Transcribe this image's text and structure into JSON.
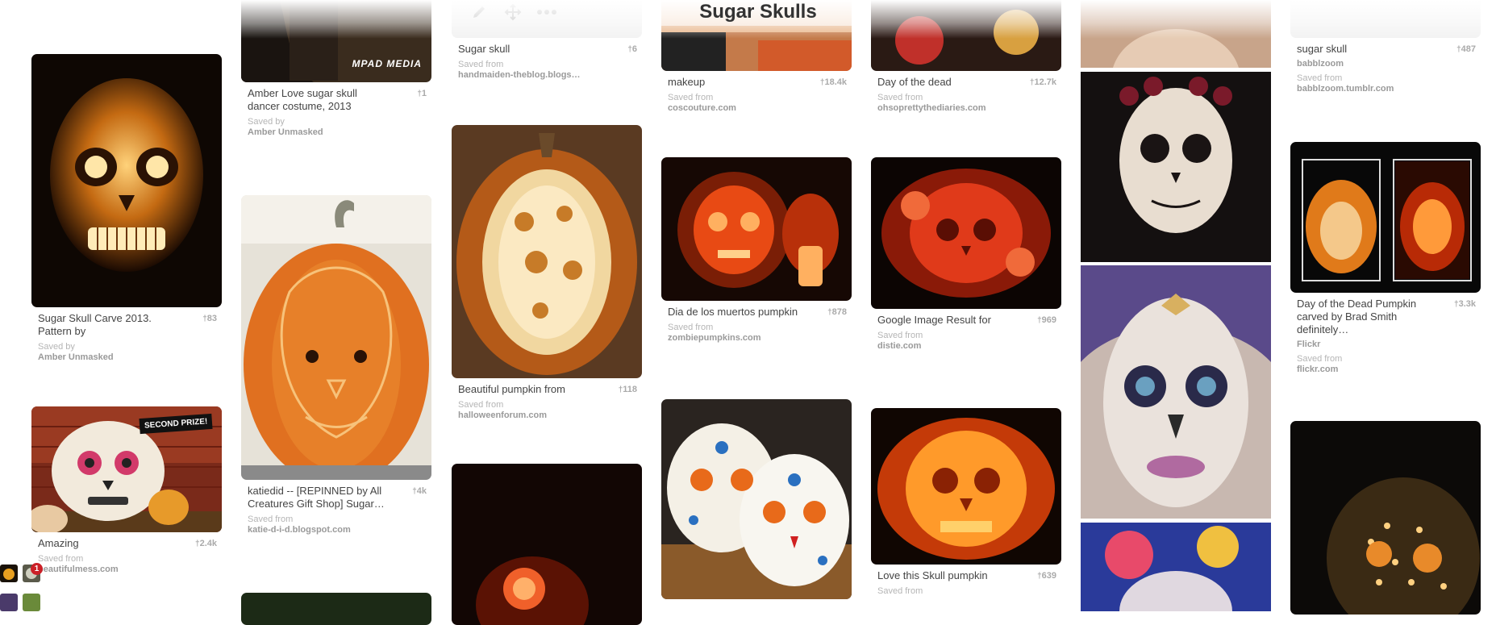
{
  "board": {
    "title": "Sugar Skulls"
  },
  "toolbar": {
    "edit_icon": "pencil-icon",
    "move_icon": "move-icon",
    "more_icon": "more-icon"
  },
  "notifications": {
    "count": "1"
  },
  "pins": {
    "p_amber_love": {
      "desc": "Amber Love sugar skull dancer costume, 2013",
      "repins": "1",
      "saved_label": "Saved by",
      "source": "Amber Unmasked",
      "watermark": "MPAD MEDIA"
    },
    "p_sugar_skull_carve": {
      "desc": "Sugar Skull Carve 2013. Pattern by",
      "repins": "83",
      "saved_label": "Saved by",
      "source": "Amber Unmasked"
    },
    "p_amazing": {
      "desc": "Amazing",
      "repins": "2.4k",
      "saved_label": "Saved from",
      "source": "beautifulmess.com",
      "banner": "SECOND PRIZE!"
    },
    "p_katiedid": {
      "desc": "katiedid -- [REPINNED by All Creatures Gift Shop] Sugar…",
      "repins": "4k",
      "saved_label": "Saved from",
      "source": "katie-d-i-d.blogspot.com"
    },
    "p_sugar_skull": {
      "desc": "Sugar skull",
      "repins": "6",
      "saved_label": "Saved from",
      "source": "handmaiden-theblog.blogs…"
    },
    "p_beautiful_pumpkin": {
      "desc": "Beautiful pumpkin from",
      "repins": "118",
      "saved_label": "Saved from",
      "source": "halloweenforum.com"
    },
    "p_makeup": {
      "desc": "makeup",
      "repins": "18.4k",
      "saved_label": "Saved from",
      "source": "coscouture.com"
    },
    "p_dia_muertos": {
      "desc": "Dia de los muertos pumpkin",
      "repins": "878",
      "saved_label": "Saved from",
      "source": "zombiepumpkins.com"
    },
    "p_day_of_dead": {
      "desc": "Day of the dead",
      "repins": "12.7k",
      "saved_label": "Saved from",
      "source": "ohsoprettythediaries.com"
    },
    "p_google_image": {
      "desc": "Google Image Result for",
      "repins": "969",
      "saved_label": "Saved from",
      "source": "distie.com"
    },
    "p_love_skull": {
      "desc": "Love this Skull pumpkin",
      "repins": "639",
      "saved_label": "Saved from"
    },
    "p_sugar_skull_babbl": {
      "desc": "sugar skull",
      "repins": "487",
      "board": "babblzoom",
      "saved_label": "Saved from",
      "source": "babblzoom.tumblr.com"
    },
    "p_brad_smith": {
      "desc": "Day of the Dead Pumpkin carved by Brad Smith definitely…",
      "repins": "3.3k",
      "board": "Flickr",
      "saved_label": "Saved from",
      "source": "flickr.com"
    }
  }
}
